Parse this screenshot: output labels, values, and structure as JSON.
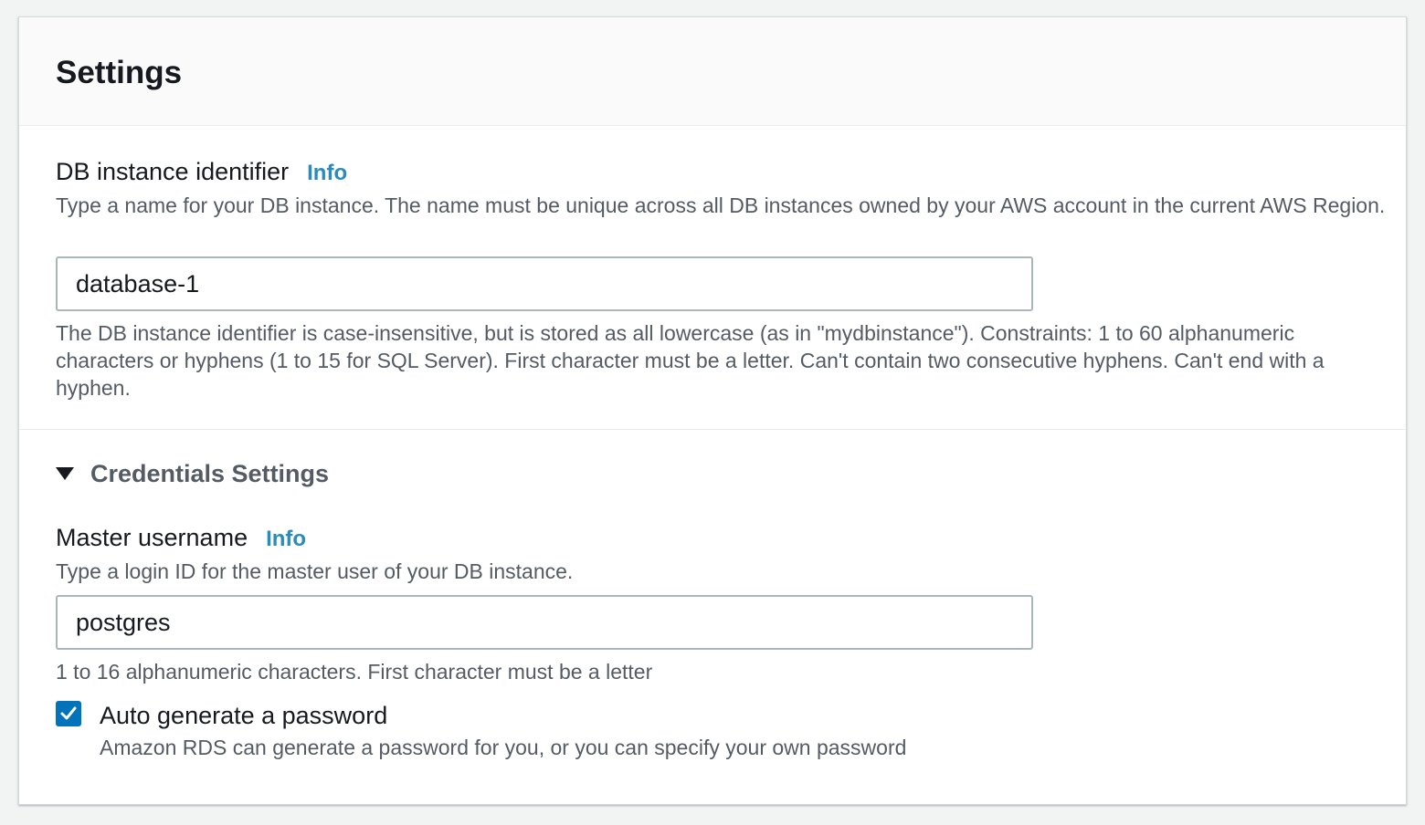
{
  "panel": {
    "title": "Settings"
  },
  "db_identifier": {
    "label": "DB instance identifier",
    "info_label": "Info",
    "description": "Type a name for your DB instance. The name must be unique across all DB instances owned by your AWS account in the current AWS Region.",
    "value": "database-1",
    "constraints": "The DB instance identifier is case-insensitive, but is stored as all lowercase (as in \"mydbinstance\"). Constraints: 1 to 60 alphanumeric characters or hyphens (1 to 15 for SQL Server). First character must be a letter. Can't contain two consecutive hyphens. Can't end with a hyphen."
  },
  "credentials": {
    "expander_label": "Credentials Settings",
    "expanded": true,
    "master_username": {
      "label": "Master username",
      "info_label": "Info",
      "description": "Type a login ID for the master user of your DB instance.",
      "value": "postgres",
      "constraints": "1 to 16 alphanumeric characters. First character must be a letter"
    },
    "auto_password": {
      "checked": true,
      "label": "Auto generate a password",
      "description": "Amazon RDS can generate a password for you, or you can specify your own password"
    }
  },
  "colors": {
    "accent": "#0073bb",
    "info_link": "#2a8bbd",
    "text_primary": "#16191f",
    "text_secondary": "#545b64",
    "page_background": "#f2f3f3",
    "header_background": "#fafafa"
  },
  "icons": {
    "expander": "caret-down-icon",
    "checkbox": "checkmark-icon"
  }
}
